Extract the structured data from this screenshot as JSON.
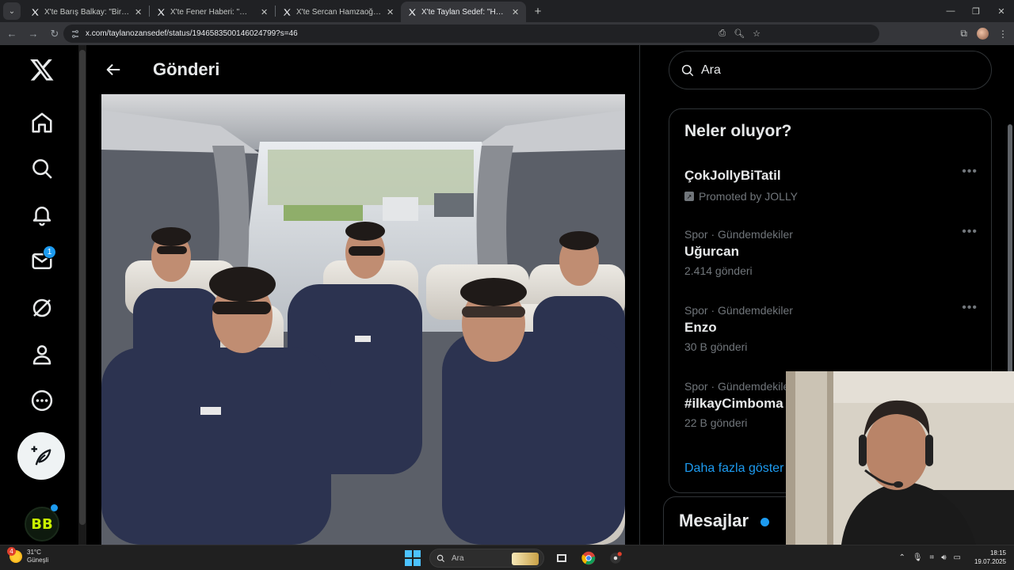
{
  "browser": {
    "tabs": [
      {
        "title": "X'te Barış Balkay: \"Birazdan yay",
        "active": false
      },
      {
        "title": "X'te Fener Haberi: \"🔴 Fenerbah",
        "active": false
      },
      {
        "title": "X'te Sercan Hamzaoğlu: \"🇹🇷 Ö",
        "active": false
      },
      {
        "title": "X'te Taylan Sedef: \"Hepsinin he",
        "active": true
      }
    ],
    "url": "x.com/taylanozansedef/status/1946583500146024799?s=46"
  },
  "leftnav": {
    "messages_badge": "1",
    "avatar_text": "BB"
  },
  "main": {
    "title": "Gönderi"
  },
  "right": {
    "search_placeholder": "Ara",
    "trends_title": "Neler oluyor?",
    "promoted": {
      "name": "ÇokJollyBiTatil",
      "label": "Promoted by JOLLY"
    },
    "trends": [
      {
        "meta": "Spor · Gündemdekiler",
        "name": "Uğurcan",
        "count": "2.414 gönderi"
      },
      {
        "meta": "Spor · Gündemdekiler",
        "name": "Enzo",
        "count": "30 B gönderi"
      },
      {
        "meta": "Spor · Gündemdekiler",
        "name": "#ilkayCimboma",
        "count": "22 B gönderi"
      }
    ],
    "show_more": "Daha fazla göster",
    "messages_title": "Mesajlar"
  },
  "taskbar": {
    "weather_temp": "31°C",
    "weather_desc": "Güneşli",
    "weather_badge": "4",
    "search_label": "Ara",
    "time": "18:15",
    "date": "19.07.2025"
  },
  "colors": {
    "accent": "#1d9bf0",
    "background": "#000000",
    "text": "#e7e9ea",
    "muted": "#71767b",
    "border": "#2f3336"
  }
}
